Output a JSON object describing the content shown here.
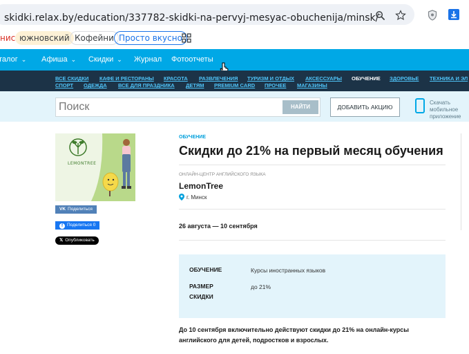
{
  "browser": {
    "url": "skidki.relax.by/education/337782-skidki-na-pervyj-mesyac-obuchenija/minsk/",
    "bookmarks": [
      "нис",
      "южновский",
      "Кофейни",
      "Просто вкусно"
    ]
  },
  "topnav": {
    "items": [
      "талог",
      "Афиша",
      "Скидки",
      "Журнал",
      "Фотоотчеты"
    ]
  },
  "categories": {
    "row1": [
      "ВСЕ СКИДКИ",
      "КАФЕ И РЕСТОРАНЫ",
      "КРАСОТА",
      "РАЗВЛЕЧЕНИЯ",
      "ТУРИЗМ И ОТДЫХ",
      "АКСЕССУАРЫ",
      "ОБУЧЕНИЕ",
      "ЗДОРОВЬЕ",
      "ТЕХНИКА И ЭЛ"
    ],
    "row2": [
      "СПОРТ",
      "ОДЕЖДА",
      "ВСЕ ДЛЯ ПРАЗДНИКА",
      "ДЕТЯМ",
      "PREMIUM CARD",
      "ПРОЧЕЕ",
      "МАГАЗИНЫ"
    ],
    "active": "ОБУЧЕНИЕ"
  },
  "search": {
    "placeholder": "Поиск",
    "button": "НАЙТИ",
    "add_button": "ДОБАВИТЬ АКЦИЮ",
    "app_text": "Скачать мобильное приложение"
  },
  "share": {
    "vk": "Поделиться",
    "fb": "Поделиться 0",
    "x": "Опубликовать"
  },
  "deal": {
    "kicker": "ОБУЧЕНИЕ",
    "title": "Скидки до 21% на первый месяц обучения",
    "org_type": "ОНЛАЙН-ЦЕНТР АНГЛИЙСКОГО ЯЗЫКА",
    "org_name": "LemonTree",
    "city": "г. Минск",
    "dates": "26 августа — 10 сентября",
    "info": [
      {
        "label_line1": "ОБУЧЕНИЕ",
        "label_line2": "",
        "value": "Курсы иностранных языков"
      },
      {
        "label_line1": "РАЗМЕР",
        "label_line2": "СКИДКИ",
        "value": "до 21%"
      }
    ],
    "description": "До 10 сентября включительно действуют скидки до 21% на онлайн-курсы английского для детей, подростков и взрослых."
  },
  "logo_text": "LEMONTREE",
  "colors": {
    "nav": "#00a8e6",
    "category_bar": "#1c3347",
    "accent": "#00a0dc",
    "info_bg": "#e3f4fb"
  }
}
